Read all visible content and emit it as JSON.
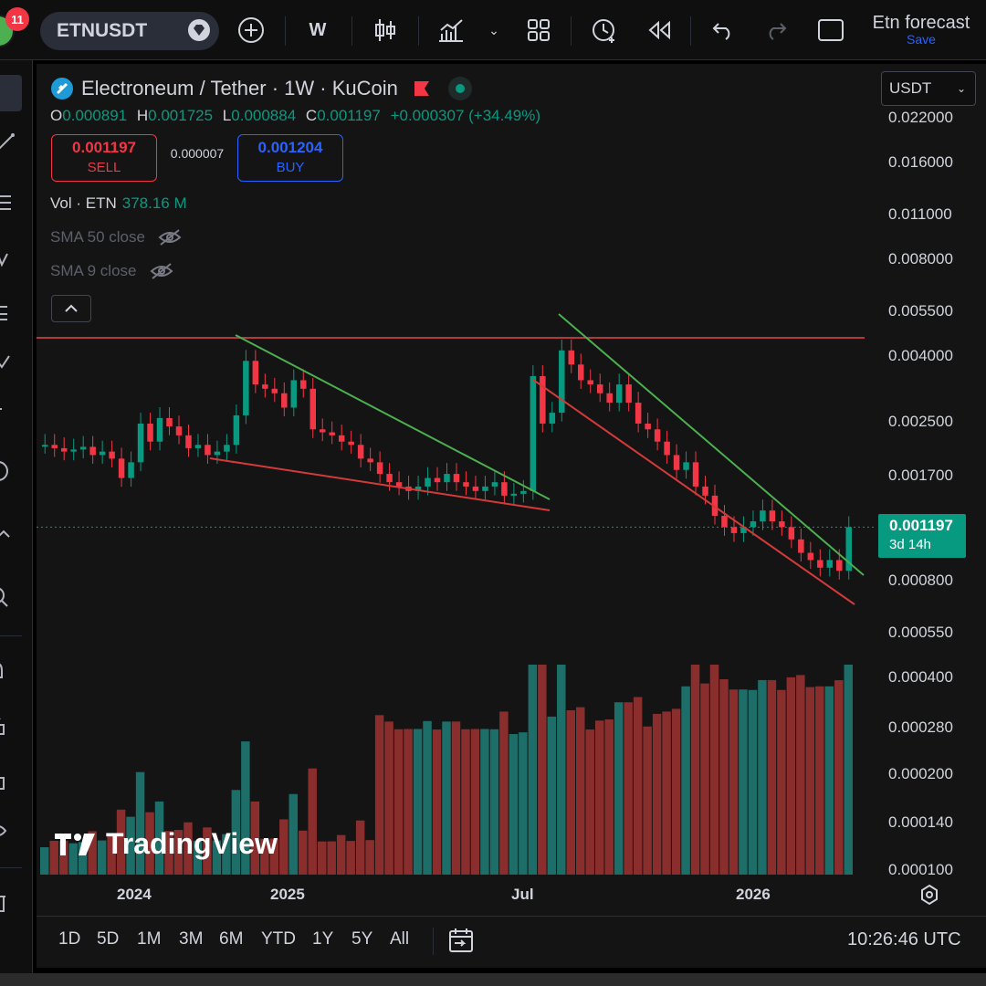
{
  "toolbar": {
    "notification_count": "11",
    "symbol": "ETNUSDT",
    "interval": "W",
    "layout_name": "Etn forecast",
    "save_label": "Save"
  },
  "legend": {
    "title": "Electroneum / Tether · 1W · KuCoin",
    "open_key": "O",
    "open": "0.000891",
    "high_key": "H",
    "high": "0.001725",
    "low_key": "L",
    "low": "0.000884",
    "close_key": "C",
    "close": "0.001197",
    "change": "+0.000307 (+34.49%)",
    "sell_price": "0.001197",
    "sell_label": "SELL",
    "spread": "0.000007",
    "buy_price": "0.001204",
    "buy_label": "BUY",
    "vol_label": "Vol · ETN",
    "vol_value": "378.16 M",
    "sma50": "SMA 50 close",
    "sma9": "SMA 9 close"
  },
  "price_axis": {
    "currency": "USDT",
    "labels": [
      "0.022000",
      "0.016000",
      "0.011000",
      "0.008000",
      "0.005500",
      "0.004000",
      "0.002500",
      "0.001700",
      "0.000800",
      "0.000550",
      "0.000400",
      "0.000280",
      "0.000200",
      "0.000140",
      "0.000100"
    ],
    "last_price": "0.001197",
    "countdown": "3d 14h"
  },
  "time_axis": {
    "labels": [
      "2024",
      "2025",
      "Jul",
      "2026"
    ]
  },
  "bottom": {
    "ranges": [
      "1D",
      "5D",
      "1M",
      "3M",
      "6M",
      "YTD",
      "1Y",
      "5Y",
      "All"
    ],
    "clock": "10:26:46 UTC"
  },
  "watermark": "TradingView",
  "colors": {
    "up": "#089981",
    "down": "#f23645",
    "vol_up": "#1d6e68",
    "vol_down": "#8a2d2d",
    "background": "#141414"
  },
  "chart_data": {
    "type": "candlestick",
    "scale": "log",
    "ylim": [
      0.0008,
      0.022
    ],
    "x": [
      "2024",
      "2025",
      "Jul",
      "2026"
    ],
    "series": [
      {
        "values": [
          0.00215,
          0.0021,
          0.00205,
          0.00208,
          0.00212,
          0.002,
          0.00205,
          0.00195,
          0.0017,
          0.0019,
          0.0025,
          0.0022,
          0.0026,
          0.00245,
          0.0023,
          0.0021,
          0.00215,
          0.002,
          0.00205,
          0.00215,
          0.00265,
          0.0039,
          0.0033,
          0.0032,
          0.0031,
          0.0028,
          0.0034,
          0.0032,
          0.0024,
          0.00235,
          0.0023,
          0.0022,
          0.00215,
          0.00195,
          0.0019,
          0.00175,
          0.00165,
          0.0016,
          0.00155,
          0.0016,
          0.0017,
          0.00165,
          0.00175,
          0.00165,
          0.0016,
          0.00155,
          0.0016,
          0.00165,
          0.0015,
          0.00152,
          0.00155,
          0.0035,
          0.0025,
          0.0027,
          0.0042,
          0.0038,
          0.0034,
          0.0033,
          0.0031,
          0.0029,
          0.0033,
          0.0029,
          0.0025,
          0.0024,
          0.0022,
          0.002,
          0.0018,
          0.0019,
          0.0016,
          0.0015,
          0.0013,
          0.0012,
          0.00115,
          0.0012,
          0.00125,
          0.00135,
          0.00125,
          0.0012,
          0.0011,
          0.001,
          0.00095,
          0.0009,
          0.00095,
          0.00088,
          0.0012
        ]
      }
    ]
  }
}
